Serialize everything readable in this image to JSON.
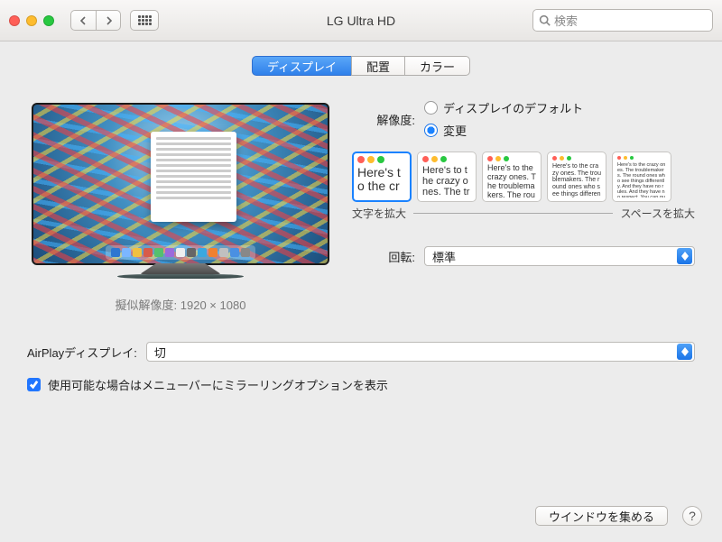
{
  "window": {
    "title": "LG Ultra HD"
  },
  "search": {
    "placeholder": "検索"
  },
  "tabs": {
    "display": "ディスプレイ",
    "arrange": "配置",
    "color": "カラー"
  },
  "preview": {
    "caption": "擬似解像度: 1920 × 1080"
  },
  "resolution": {
    "label": "解像度:",
    "default_opt": "ディスプレイのデフォルト",
    "scaled_opt": "変更",
    "left_label": "文字を拡大",
    "right_label": "スペースを拡大",
    "sample_text": "Here's to the crazy ones. The troublemakers. The round ones who see things differently. And they have no rules. And they have no respect. You can quote them, disagree with them. About the only thing. Because they change"
  },
  "rotation": {
    "label": "回転:",
    "value": "標準"
  },
  "airplay": {
    "label": "AirPlayディスプレイ:",
    "value": "切"
  },
  "mirroring_checkbox": "使用可能な場合はメニューバーにミラーリングオプションを表示",
  "gather_button": "ウインドウを集める",
  "help": "?"
}
